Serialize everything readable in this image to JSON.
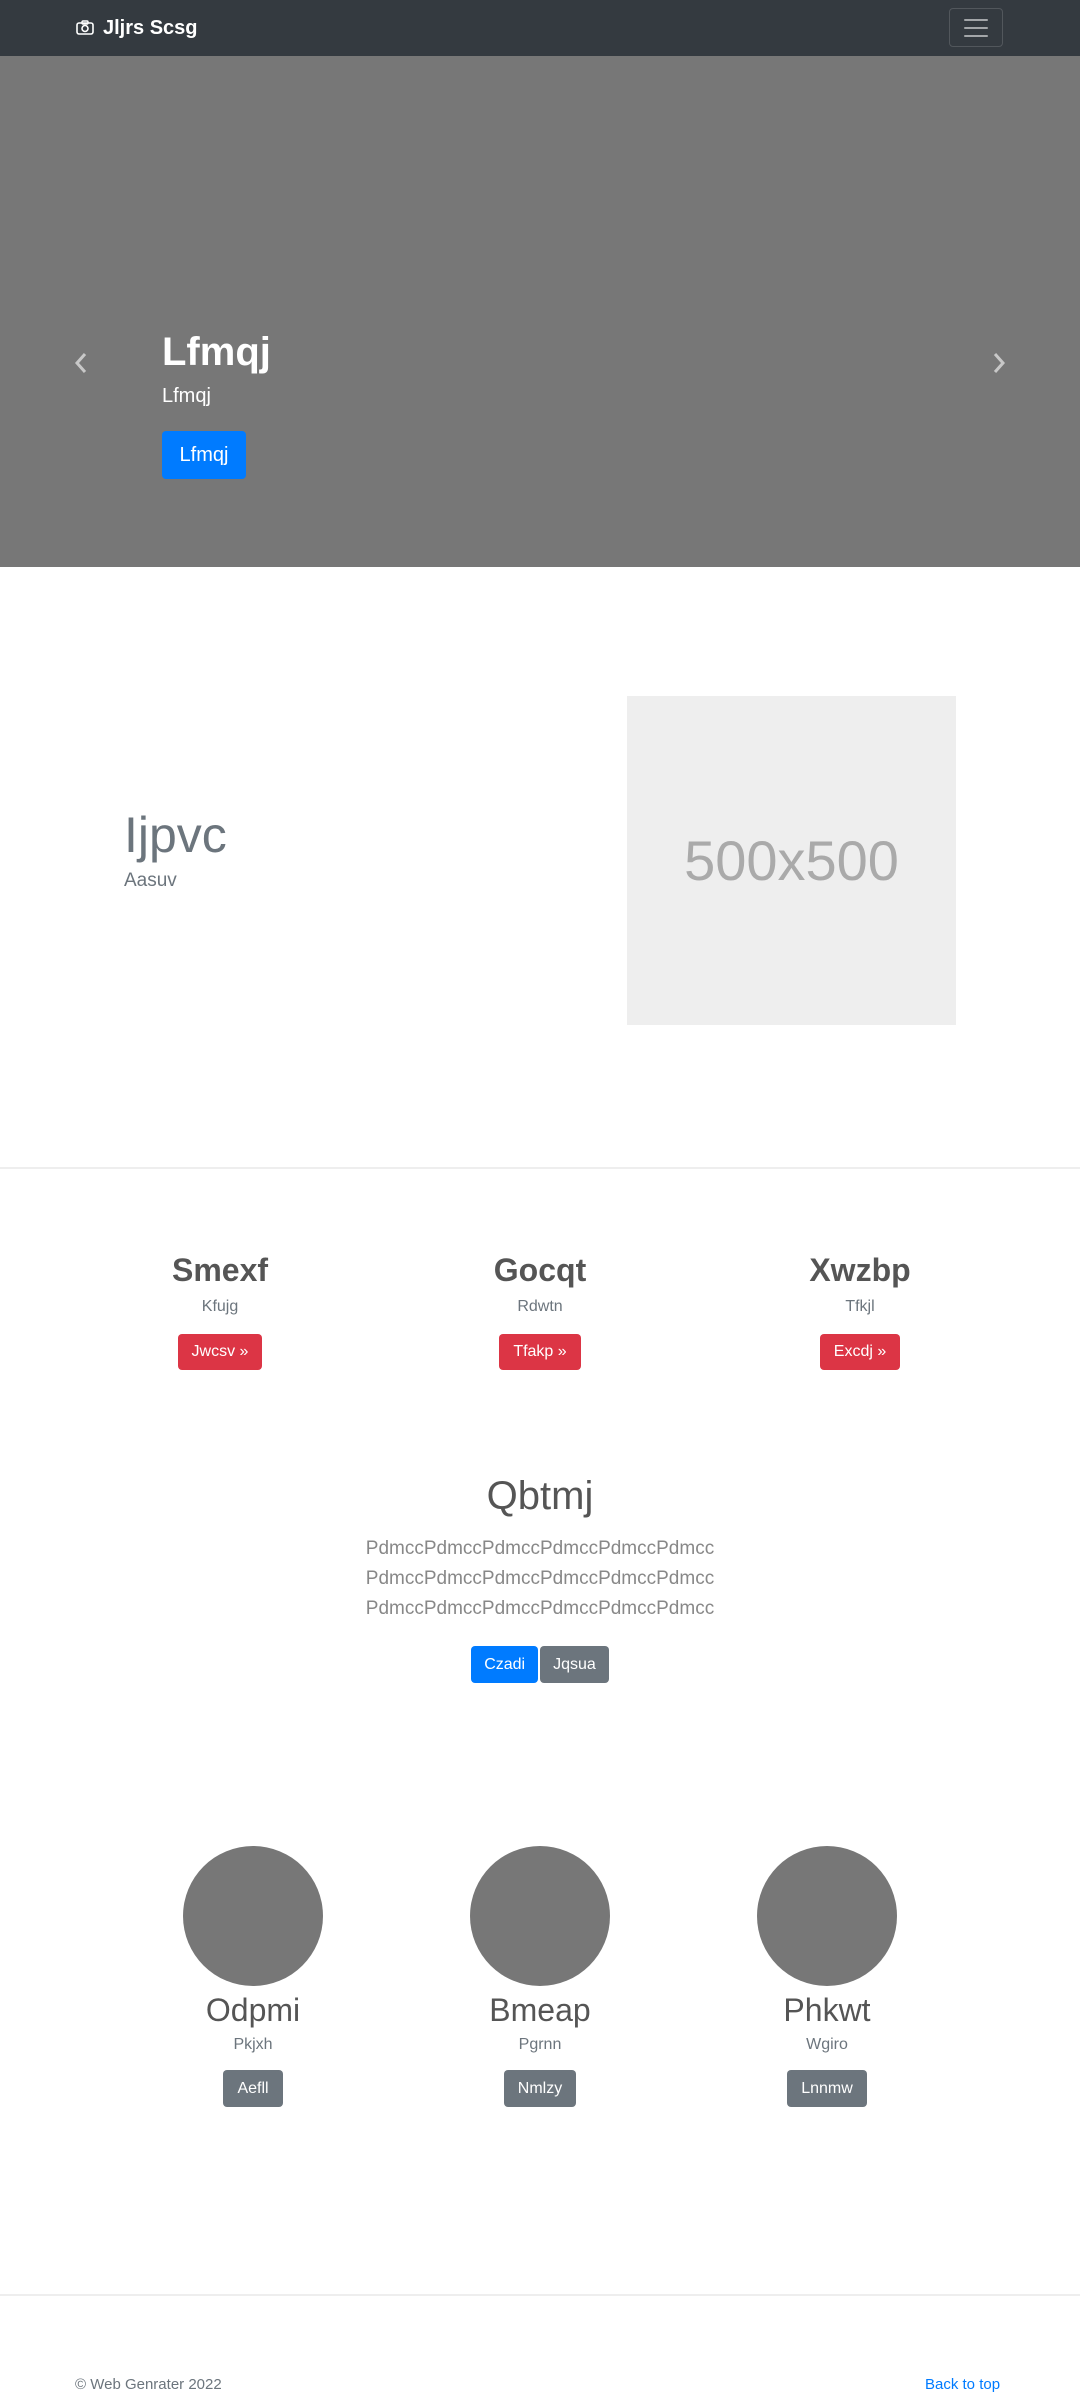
{
  "navbar": {
    "brand": "Jljrs Scsg",
    "brand_icon": "camera-icon",
    "menu_icon": "hamburger-menu-icon"
  },
  "hero": {
    "title": "Lfmqj",
    "subtitle": "Lfmqj",
    "button": "Lfmqj",
    "prev_icon": "chevron-left-icon",
    "next_icon": "chevron-right-icon",
    "slides": 3,
    "active_slide": 1
  },
  "feature": {
    "title": "Ijpvc",
    "subtitle": "Aasuv",
    "image_text": "500x500"
  },
  "columns": [
    {
      "title": "Smexf",
      "text": "Kfujg",
      "button": "Jwcsv »"
    },
    {
      "title": "Gocqt",
      "text": "Rdwtn",
      "button": "Tfakp »"
    },
    {
      "title": "Xwzbp",
      "text": "Tfkjl",
      "button": "Excdj »"
    }
  ],
  "center": {
    "title": "Qbtmj",
    "lines": [
      "PdmccPdmccPdmccPdmccPdmccPdmcc",
      "PdmccPdmccPdmccPdmccPdmccPdmcc",
      "PdmccPdmccPdmccPdmccPdmccPdmcc"
    ],
    "primary_button": "Czadi",
    "secondary_button": "Jqsua"
  },
  "people": [
    {
      "name": "Odpmi",
      "text": "Pkjxh",
      "button": "Aefll"
    },
    {
      "name": "Bmeap",
      "text": "Pgrnn",
      "button": "Nmlzy"
    },
    {
      "name": "Phkwt",
      "text": "Wgiro",
      "button": "Lnnmw"
    }
  ],
  "footer": {
    "copyright": "© Web Genrater 2022",
    "back_to_top": "Back to top"
  },
  "colors": {
    "navbar": "#343a40",
    "hero": "#777777",
    "primary": "#007bff",
    "danger": "#dc3545",
    "secondary": "#6c757d"
  }
}
